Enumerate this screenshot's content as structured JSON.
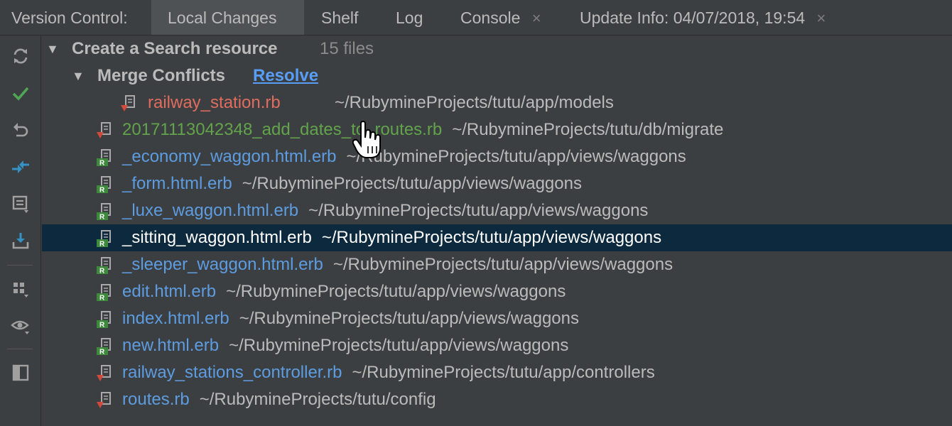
{
  "header": {
    "title": "Version Control:",
    "tabs": [
      {
        "label": "Local Changes",
        "active": true,
        "closable": false
      },
      {
        "label": "Shelf",
        "active": false,
        "closable": false
      },
      {
        "label": "Log",
        "active": false,
        "closable": false
      },
      {
        "label": "Console",
        "active": false,
        "closable": true
      },
      {
        "label": "Update Info: 04/07/2018, 19:54",
        "active": false,
        "closable": true
      }
    ],
    "close_glyph": "×"
  },
  "toolbar": {
    "buttons": [
      {
        "icon": "refresh-icon"
      },
      {
        "icon": "commit-check-icon"
      },
      {
        "icon": "rollback-icon"
      },
      {
        "icon": "diff-icon"
      },
      {
        "icon": "changelist-icon"
      },
      {
        "icon": "shelve-icon"
      },
      {
        "icon": "group-by-icon"
      },
      {
        "icon": "eye-icon"
      },
      {
        "icon": "preview-panel-icon"
      }
    ]
  },
  "tree": {
    "changelist": {
      "label": "Create a Search resource",
      "count": "15 files",
      "expanded": true
    },
    "merge_conflicts": {
      "label": "Merge Conflicts",
      "resolve_label": "Resolve",
      "expanded": true
    },
    "conflict_files": [
      {
        "name": "railway_station.rb",
        "path": "~/RubymineProjects/tutu/app/models"
      }
    ],
    "files": [
      {
        "name": "20171113042348_add_dates_to_routes.rb",
        "path": "~/RubymineProjects/tutu/db/migrate",
        "status": "added",
        "icon": "ruby-file-icon"
      },
      {
        "name": "_economy_waggon.html.erb",
        "path": "~/RubymineProjects/tutu/app/views/waggons",
        "status": "modified",
        "icon": "erb-file-icon"
      },
      {
        "name": "_form.html.erb",
        "path": "~/RubymineProjects/tutu/app/views/waggons",
        "status": "modified",
        "icon": "erb-file-icon"
      },
      {
        "name": "_luxe_waggon.html.erb",
        "path": "~/RubymineProjects/tutu/app/views/waggons",
        "status": "modified",
        "icon": "erb-file-icon"
      },
      {
        "name": "_sitting_waggon.html.erb",
        "path": "~/RubymineProjects/tutu/app/views/waggons",
        "status": "selected",
        "icon": "erb-file-icon"
      },
      {
        "name": "_sleeper_waggon.html.erb",
        "path": "~/RubymineProjects/tutu/app/views/waggons",
        "status": "modified",
        "icon": "erb-file-icon"
      },
      {
        "name": "edit.html.erb",
        "path": "~/RubymineProjects/tutu/app/views/waggons",
        "status": "modified",
        "icon": "erb-file-icon"
      },
      {
        "name": "index.html.erb",
        "path": "~/RubymineProjects/tutu/app/views/waggons",
        "status": "modified",
        "icon": "erb-file-icon"
      },
      {
        "name": "new.html.erb",
        "path": "~/RubymineProjects/tutu/app/views/waggons",
        "status": "modified",
        "icon": "erb-file-icon"
      },
      {
        "name": "railway_stations_controller.rb",
        "path": "~/RubymineProjects/tutu/app/controllers",
        "status": "modified",
        "icon": "ruby-file-icon"
      },
      {
        "name": "routes.rb",
        "path": "~/RubymineProjects/tutu/config",
        "status": "modified",
        "icon": "ruby-file-icon"
      }
    ]
  },
  "colors": {
    "background": "#3c3f41",
    "selection": "#0d293e",
    "conflict": "#e06c5f",
    "added": "#62a34b",
    "modified": "#5d9ce0",
    "link": "#589df6"
  }
}
